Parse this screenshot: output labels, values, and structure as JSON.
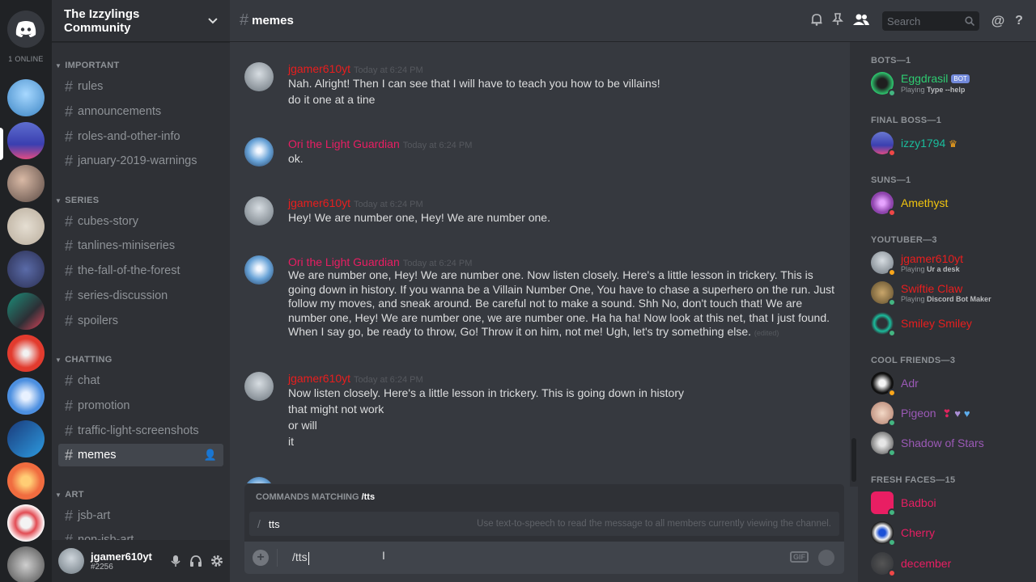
{
  "servers": {
    "online_label": "1 ONLINE"
  },
  "guild": {
    "name": "The Izzylings Community"
  },
  "channels": {
    "categories": [
      {
        "name": "IMPORTANT",
        "items": [
          "rules",
          "announcements",
          "roles-and-other-info",
          "january-2019-warnings"
        ]
      },
      {
        "name": "SERIES",
        "items": [
          "cubes-story",
          "tanlines-miniseries",
          "the-fall-of-the-forest",
          "series-discussion",
          "spoilers"
        ]
      },
      {
        "name": "CHATTING",
        "items": [
          "chat",
          "promotion",
          "traffic-light-screenshots",
          "memes"
        ]
      },
      {
        "name": "ART",
        "items": [
          "jsb-art",
          "non-jsb-art"
        ]
      }
    ],
    "active": "memes"
  },
  "user_panel": {
    "username": "jgamer610yt",
    "tag": "#2256"
  },
  "topbar": {
    "channel": "memes",
    "search_placeholder": "Search"
  },
  "messages": [
    {
      "author": "jgamer610yt",
      "author_color": "#e91e1e",
      "timestamp": "Today at 6:24 PM",
      "lines": [
        "Nah. Alright! Then I can see that I will have to teach you how to be villains!",
        "do it one at a tine"
      ]
    },
    {
      "author": "Ori the Light Guardian",
      "author_color": "#e91e63",
      "timestamp": "Today at 6:24 PM",
      "lines": [
        "ok."
      ]
    },
    {
      "author": "jgamer610yt",
      "author_color": "#e91e1e",
      "timestamp": "Today at 6:24 PM",
      "lines": [
        "Hey! We are number one, Hey! We are number one."
      ]
    },
    {
      "author": "Ori the Light Guardian",
      "author_color": "#e91e63",
      "timestamp": "Today at 6:24 PM",
      "lines": [
        "We are number one, Hey! We are number one. Now listen closely. Here's a little lesson in trickery. This is going down in history. If you wanna be a Villain Number One, You have to chase a superhero on the run. Just follow my moves, and sneak around. Be careful not to make a sound. Shh No, don't touch that! We are number one, Hey! We are number one, we are number one. Ha ha ha! Now look at this net, that I just found. When I say go, be ready to throw, Go! Throw it on him, not me! Ugh, let's try something else."
      ],
      "edited": "(edited)"
    },
    {
      "author": "jgamer610yt",
      "author_color": "#e91e1e",
      "timestamp": "Today at 6:24 PM",
      "lines": [
        "Now listen closely. Here's a little lesson in trickery. This is going down in history",
        "that might not work",
        "or will",
        "it"
      ]
    }
  ],
  "autocomplete": {
    "header_prefix": "COMMANDS MATCHING",
    "query": "/tts",
    "command": "tts",
    "description": "Use text-to-speech to read the message to all members currently viewing the channel."
  },
  "composer": {
    "value": "/tts",
    "gif_label": "GIF"
  },
  "members": [
    {
      "group": "BOTS—1",
      "items": [
        {
          "name": "Eggdrasil",
          "color": "#2ecc71",
          "badge": "BOT",
          "activity_prefix": "Playing",
          "activity": "Type --help",
          "status": "#43b581"
        }
      ]
    },
    {
      "group": "FINAL BOSS—1",
      "items": [
        {
          "name": "izzy1794",
          "color": "#1abc9c",
          "crown": "♛",
          "status": "#f04747"
        }
      ]
    },
    {
      "group": "SUNS—1",
      "items": [
        {
          "name": "Amethyst",
          "color": "#f1c40f",
          "status": "#f04747"
        }
      ]
    },
    {
      "group": "YOUTUBER—3",
      "items": [
        {
          "name": "jgamer610yt",
          "color": "#e91e1e",
          "activity_prefix": "Playing",
          "activity": "Ur a desk",
          "status": "#faa61a"
        },
        {
          "name": "Swiftie Claw",
          "color": "#e91e1e",
          "activity_prefix": "Playing",
          "activity": "Discord Bot Maker",
          "status": "#43b581"
        },
        {
          "name": "Smiley Smiley",
          "color": "#e91e1e",
          "status": "#43b581"
        }
      ]
    },
    {
      "group": "COOL FRIENDS—3",
      "items": [
        {
          "name": "Adr",
          "color": "#9b59b6",
          "status": "#faa61a"
        },
        {
          "name": "Pigeon",
          "color": "#9b59b6",
          "hearts": [
            "❣",
            "♥",
            "♥"
          ],
          "status": "#43b581"
        },
        {
          "name": "Shadow of Stars",
          "color": "#9b59b6",
          "status": "#43b581"
        }
      ]
    },
    {
      "group": "FRESH FACES—15",
      "items": [
        {
          "name": "Badboi",
          "color": "#e91e63",
          "status": "#43b581"
        },
        {
          "name": "Cherry",
          "color": "#e91e63",
          "status": "#43b581"
        },
        {
          "name": "december",
          "color": "#e91e63",
          "status": "#f04747"
        }
      ]
    }
  ]
}
